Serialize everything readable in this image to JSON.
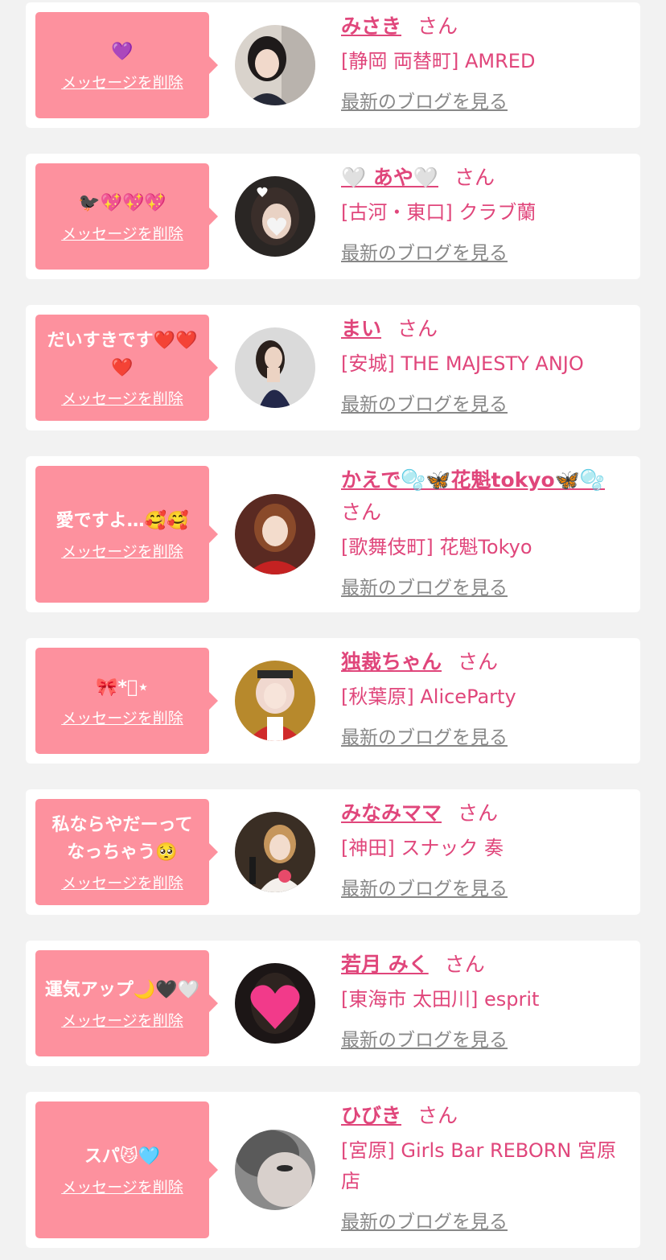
{
  "delete_label": "メッセージを削除",
  "blog_label": "最新のブログを見る",
  "honorific": "さん",
  "colors": {
    "background": "#f2f2f2",
    "card": "#ffffff",
    "bubble": "#fd919e",
    "name": "#e0467b",
    "link_gray": "#888888"
  },
  "messages": [
    {
      "message": "💜",
      "name": "みさき",
      "shop": "[静岡 両替町] AMRED",
      "avatar_icon": "woman-black-hair-avatar"
    },
    {
      "message": "🐦‍⬛💖💖💖",
      "name": "🤍 あや🤍",
      "shop": "[古河・東口] クラブ蘭",
      "avatar_icon": "woman-heart-sticker-avatar"
    },
    {
      "message": "だいすきです❤️❤️❤️",
      "name": "まい",
      "shop": "[安城] THE MAJESTY ANJO",
      "avatar_icon": "woman-navy-dress-avatar"
    },
    {
      "message": "愛ですよ…🥰🥰",
      "name": "かえで🫧🦋花魁tokyo🦋🫧",
      "shop": "[歌舞伎町] 花魁Tokyo",
      "avatar_icon": "woman-red-kimono-avatar"
    },
    {
      "message": "🎀*ﾟ⋆",
      "name": "独裁ちゃん",
      "shop": "[秋葉原] AliceParty",
      "avatar_icon": "woman-maid-costume-avatar"
    },
    {
      "message": "私ならやだーってなっちゃう🥺",
      "name": "みなみママ",
      "shop": "[神田] スナック 奏",
      "avatar_icon": "woman-bar-flowers-avatar"
    },
    {
      "message": "運気アップ🌙🖤🤍",
      "name": "若月 みく",
      "shop": "[東海市 太田川] esprit",
      "avatar_icon": "woman-heart-covered-avatar"
    },
    {
      "message": "スパ😼🩵",
      "name": "ひびき",
      "shop": "[宮原] Girls Bar REBORN 宮原店",
      "avatar_icon": "woman-closeup-gray-avatar"
    }
  ]
}
